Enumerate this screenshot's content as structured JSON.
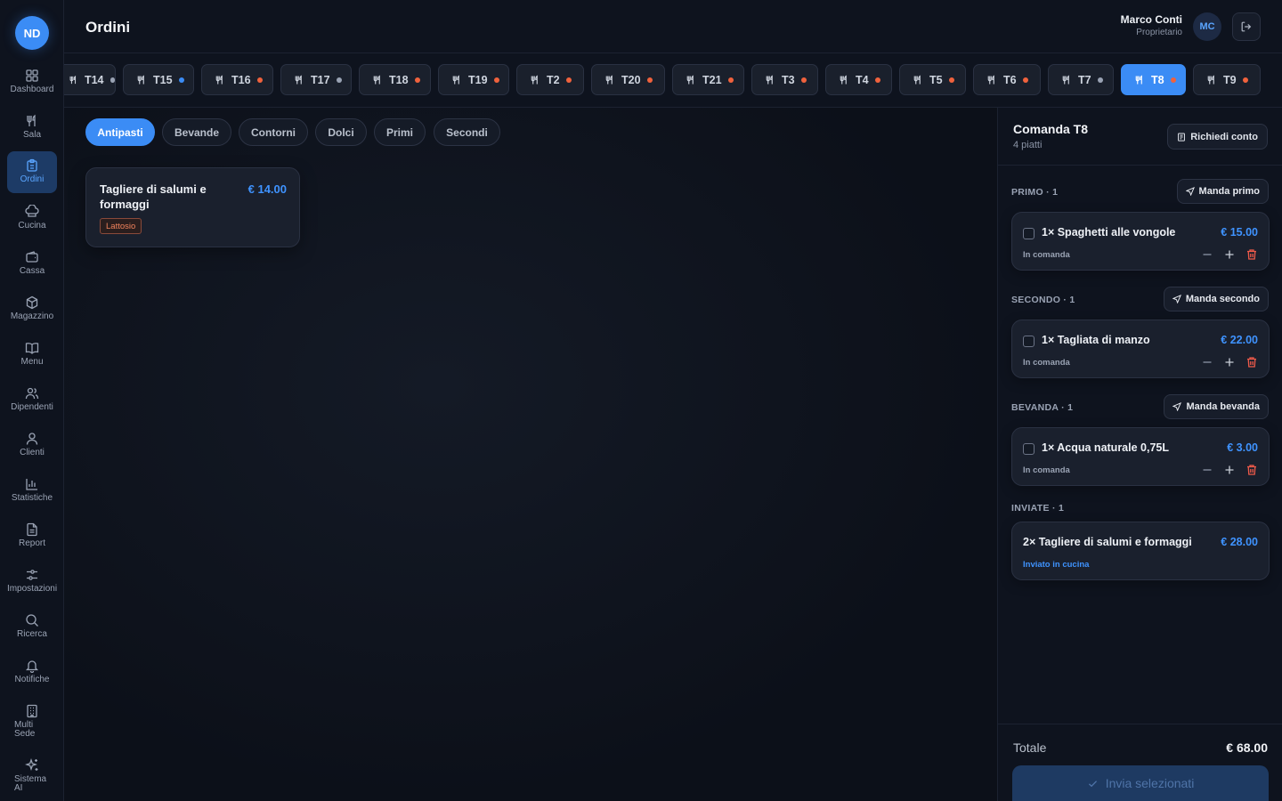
{
  "app": {
    "logo": "ND",
    "page_title": "Ordini"
  },
  "user": {
    "name": "Marco Conti",
    "role": "Proprietario",
    "initials": "MC"
  },
  "sidebar": {
    "items": [
      {
        "label": "Dashboard",
        "icon": "grid-icon"
      },
      {
        "label": "Sala",
        "icon": "utensils-icon"
      },
      {
        "label": "Ordini",
        "icon": "clipboard-icon",
        "active": true
      },
      {
        "label": "Cucina",
        "icon": "chef-hat-icon"
      },
      {
        "label": "Cassa",
        "icon": "wallet-icon"
      },
      {
        "label": "Magazzino",
        "icon": "package-icon"
      },
      {
        "label": "Menu",
        "icon": "book-icon"
      },
      {
        "label": "Dipendenti",
        "icon": "users-icon"
      },
      {
        "label": "Clienti",
        "icon": "user-icon"
      },
      {
        "label": "Statistiche",
        "icon": "bar-chart-icon"
      },
      {
        "label": "Report",
        "icon": "file-text-icon"
      },
      {
        "label": "Impostazioni",
        "icon": "sliders-icon"
      },
      {
        "label": "Ricerca",
        "icon": "search-icon"
      },
      {
        "label": "Notifiche",
        "icon": "bell-icon"
      },
      {
        "label": "Multi\nSede",
        "icon": "building-icon"
      },
      {
        "label": "Sistema\nAI",
        "icon": "sparkles-icon"
      }
    ]
  },
  "tables": [
    {
      "label": "T14",
      "status_color": "#9aa3b4"
    },
    {
      "label": "T15",
      "status_color": "#3b8cf5"
    },
    {
      "label": "T16",
      "status_color": "#f0623d"
    },
    {
      "label": "T17",
      "status_color": "#9aa3b4"
    },
    {
      "label": "T18",
      "status_color": "#f0623d"
    },
    {
      "label": "T19",
      "status_color": "#f0623d"
    },
    {
      "label": "T2",
      "status_color": "#f0623d"
    },
    {
      "label": "T20",
      "status_color": "#f0623d"
    },
    {
      "label": "T21",
      "status_color": "#f0623d"
    },
    {
      "label": "T3",
      "status_color": "#f0623d"
    },
    {
      "label": "T4",
      "status_color": "#f0623d"
    },
    {
      "label": "T5",
      "status_color": "#f0623d"
    },
    {
      "label": "T6",
      "status_color": "#f0623d"
    },
    {
      "label": "T7",
      "status_color": "#9aa3b4"
    },
    {
      "label": "T8",
      "status_color": "#f0623d",
      "active": true
    },
    {
      "label": "T9",
      "status_color": "#f0623d"
    }
  ],
  "categories": [
    {
      "label": "Antipasti",
      "active": true
    },
    {
      "label": "Bevande"
    },
    {
      "label": "Contorni"
    },
    {
      "label": "Dolci"
    },
    {
      "label": "Primi"
    },
    {
      "label": "Secondi"
    }
  ],
  "products": [
    {
      "name": "Tagliere di salumi e formaggi",
      "price": "€ 14.00",
      "allergen": "Lattosio"
    }
  ],
  "order": {
    "title": "Comanda T8",
    "subtitle": "4 piatti",
    "request_bill": "Richiedi conto",
    "sections": [
      {
        "label": "PRIMO · 1",
        "send_label": "Manda primo",
        "items": [
          {
            "name": "1× Spaghetti alle vongole",
            "price": "€ 15.00",
            "status": "In comanda"
          }
        ]
      },
      {
        "label": "SECONDO · 1",
        "send_label": "Manda secondo",
        "items": [
          {
            "name": "1× Tagliata di manzo",
            "price": "€ 22.00",
            "status": "In comanda"
          }
        ]
      },
      {
        "label": "BEVANDA · 1",
        "send_label": "Manda bevanda",
        "items": [
          {
            "name": "1× Acqua naturale 0,75L",
            "price": "€ 3.00",
            "status": "In comanda"
          }
        ]
      },
      {
        "label": "INVIATE · 1",
        "items": [
          {
            "name": "2× Tagliere di salumi e formaggi",
            "price": "€ 28.00",
            "status": "Inviato in cucina"
          }
        ]
      }
    ],
    "total_label": "Totale",
    "total_value": "€ 68.00",
    "send_selected": "Invia selezionati"
  }
}
